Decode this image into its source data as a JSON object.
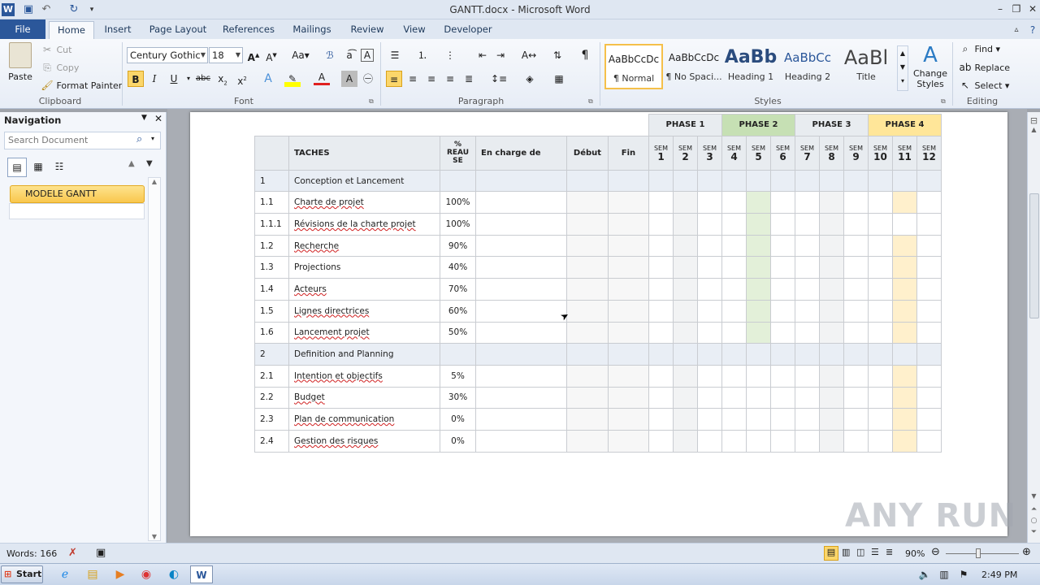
{
  "window": {
    "title": "GANTT.docx - Microsoft Word"
  },
  "tabs": [
    {
      "label": "File"
    },
    {
      "label": "Home"
    },
    {
      "label": "Insert"
    },
    {
      "label": "Page Layout"
    },
    {
      "label": "References"
    },
    {
      "label": "Mailings"
    },
    {
      "label": "Review"
    },
    {
      "label": "View"
    },
    {
      "label": "Developer"
    }
  ],
  "clipboard": {
    "paste": "Paste",
    "cut": "Cut",
    "copy": "Copy",
    "format_painter": "Format Painter",
    "label": "Clipboard"
  },
  "font": {
    "name": "Century Gothic",
    "size": "18",
    "label": "Font"
  },
  "paragraph": {
    "label": "Paragraph"
  },
  "styles": {
    "label": "Styles",
    "items": [
      {
        "preview": "AaBbCcDc",
        "name": "¶ Normal"
      },
      {
        "preview": "AaBbCcDc",
        "name": "¶ No Spaci..."
      },
      {
        "preview": "AaBb",
        "name": "Heading 1"
      },
      {
        "preview": "AaBbCc",
        "name": "Heading 2"
      },
      {
        "preview": "AaBl",
        "name": "Title"
      }
    ],
    "change_styles": "Change Styles"
  },
  "editing": {
    "find": "Find",
    "replace": "Replace",
    "select": "Select",
    "label": "Editing"
  },
  "navigation": {
    "title": "Navigation",
    "search_placeholder": "Search Document",
    "item": "MODELE GANTT"
  },
  "table": {
    "headers": {
      "taches": "TACHES",
      "realise_1": "%",
      "realise_2": "REAU",
      "realise_3": "SE",
      "charge": "En charge de",
      "debut": "Début",
      "fin": "Fin"
    },
    "phases": [
      "PHASE 1",
      "PHASE 2",
      "PHASE 3",
      "PHASE 4"
    ],
    "sem_label": "SEM",
    "weeks": [
      "1",
      "2",
      "3",
      "4",
      "5",
      "6",
      "7",
      "8",
      "9",
      "10",
      "11",
      "12"
    ],
    "rows": [
      {
        "num": "1",
        "task": "Conception et  Lancement",
        "pct": "",
        "section": true
      },
      {
        "num": "1.1",
        "task": "Charte de projet",
        "pct": "100%"
      },
      {
        "num": "1.1.1",
        "task": "Révisions de la charte projet",
        "pct": "100%"
      },
      {
        "num": "1.2",
        "task": "Recherche",
        "pct": "90%"
      },
      {
        "num": "1.3",
        "task": "Projections",
        "pct": "40%"
      },
      {
        "num": "1.4",
        "task": "Acteurs",
        "pct": "70%"
      },
      {
        "num": "1.5",
        "task": "Lignes directrices",
        "pct": "60%"
      },
      {
        "num": "1.6",
        "task": "Lancement projet",
        "pct": "50%"
      },
      {
        "num": "2",
        "task": "Definition and Planning",
        "pct": "",
        "section": true
      },
      {
        "num": "2.1",
        "task": "Intention et objectifs",
        "pct": "5%"
      },
      {
        "num": "2.2",
        "task": "Budget",
        "pct": "30%"
      },
      {
        "num": "2.3",
        "task": "Plan de communication",
        "pct": "0%"
      },
      {
        "num": "2.4",
        "task": "Gestion des risques",
        "pct": "0%"
      }
    ]
  },
  "status": {
    "words": "Words: 166",
    "zoom": "90%"
  },
  "taskbar": {
    "start": "Start",
    "time": "2:49 PM"
  },
  "watermark": "ANY RUN",
  "colors": {
    "phase1": "#e8ecf0",
    "phase2": "#c6e0b4",
    "phase3": "#e8ecf0",
    "phase4": "#ffe699",
    "file_tab": "#2b579a"
  }
}
